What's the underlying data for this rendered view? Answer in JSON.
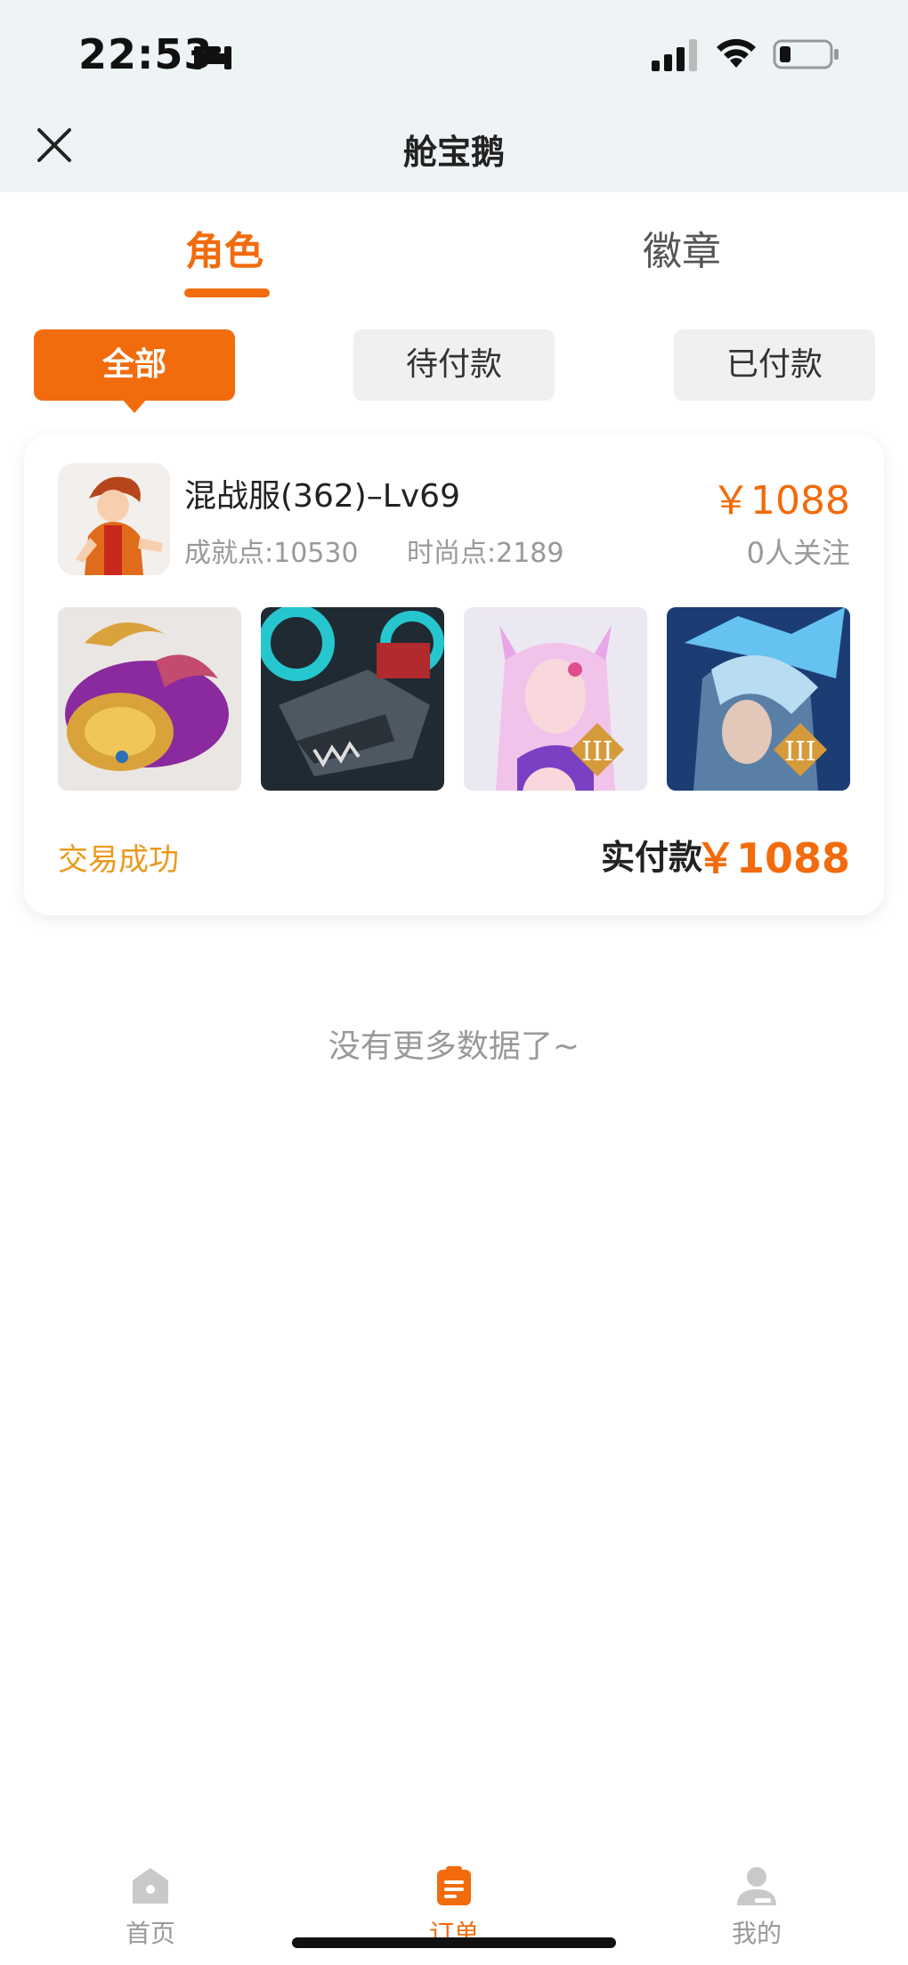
{
  "status_bar": {
    "time": "22:53",
    "icons": [
      "bed-icon",
      "signal-icon",
      "wifi-icon",
      "battery-icon"
    ]
  },
  "header": {
    "title": "舱宝鹅",
    "close_icon": "close-icon"
  },
  "tabs": [
    {
      "label": "角色",
      "active": true
    },
    {
      "label": "徽章",
      "active": false
    }
  ],
  "filters": [
    {
      "label": "全部",
      "active": true
    },
    {
      "label": "待付款",
      "active": false
    },
    {
      "label": "已付款",
      "active": false
    }
  ],
  "order": {
    "role_name": "混战服(362)–Lv69",
    "achievement": "成就点:10530",
    "fashion": "时尚点:2189",
    "price": "￥1088",
    "followers": "0人关注",
    "status": "交易成功",
    "paid_label": "实付款",
    "paid_amount": "￥1088",
    "thumbnails": [
      "pet-fish-image",
      "mech-wolf-image",
      "fox-girl-skin-image",
      "ice-armor-skin-image"
    ]
  },
  "list_footer": "没有更多数据了~",
  "bottom_nav": [
    {
      "label": "首页",
      "icon": "home-icon",
      "active": false
    },
    {
      "label": "订单",
      "icon": "clipboard-icon",
      "active": true
    },
    {
      "label": "我的",
      "icon": "user-icon",
      "active": false
    }
  ],
  "colors": {
    "accent": "#f26b0c",
    "success_text": "#e99a1d",
    "header_bg": "#eef3f6",
    "muted_text": "#999999"
  }
}
